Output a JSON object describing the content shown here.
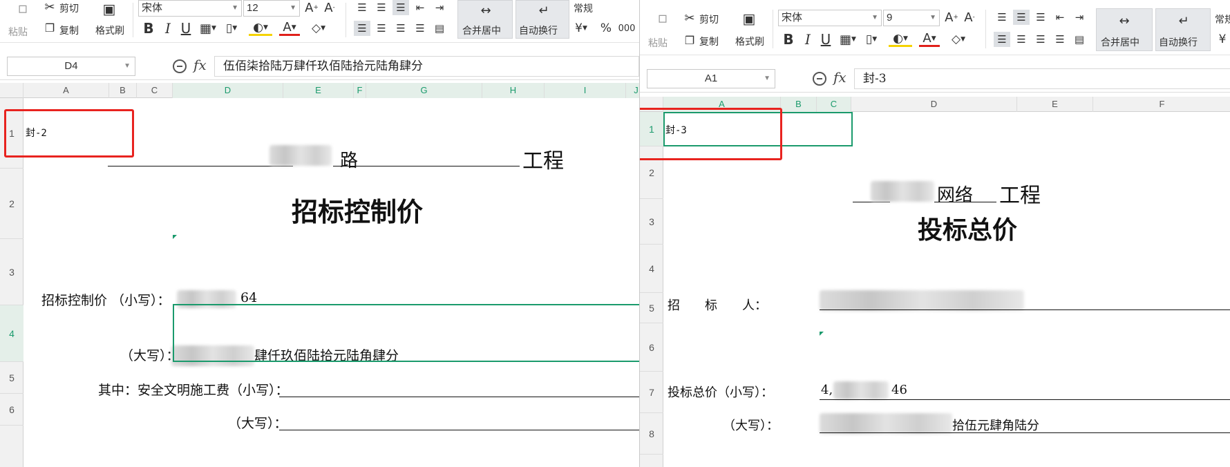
{
  "left": {
    "toolbar": {
      "cut": "剪切",
      "copy": "复制",
      "paste": "粘贴",
      "format_painter": "格式刷",
      "font_name": "宋体",
      "font_size": "12",
      "merge_center": "合并居中",
      "wrap_text": "自动换行",
      "number_format": "常规"
    },
    "name_box": "D4",
    "formula": "伍佰柒拾陆万肆仟玖佰陆拾元陆角肆分",
    "columns": [
      "A",
      "B",
      "C",
      "D",
      "E",
      "F",
      "G",
      "H",
      "I",
      "J"
    ],
    "rows": [
      "1",
      "2",
      "3",
      "4",
      "5",
      "6"
    ],
    "cells": {
      "a1": "封-2",
      "project_suffix": "工程",
      "project_mid": "路",
      "title": "招标控制价",
      "price_small_label": "招标控制价 （小写）：",
      "price_small_value": "64",
      "price_big_label": "（大写）：",
      "price_big_value": "肆仟玖佰陆拾元陆角肆分",
      "safety_small_label": "其中：安全文明施工费（小写）：",
      "safety_big_label": "（大写）："
    }
  },
  "right": {
    "toolbar": {
      "cut": "剪切",
      "copy": "复制",
      "paste": "粘贴",
      "format_painter": "格式刷",
      "font_name": "宋体",
      "font_size": "9",
      "merge_center": "合并居中",
      "wrap_text": "自动换行",
      "number_format": "常规"
    },
    "name_box": "A1",
    "formula": "封-3",
    "columns": [
      "A",
      "B",
      "C",
      "D",
      "E",
      "F"
    ],
    "rows": [
      "1",
      "2",
      "3",
      "4",
      "5",
      "6",
      "7",
      "8"
    ],
    "cells": {
      "a1": "封-3",
      "project_mid": "网络",
      "project_suffix": "工程",
      "title": "投标总价",
      "bidder_label": "招　　标　　人：",
      "total_small_label": "投标总价（小写）：",
      "total_small_prefix": "4,",
      "total_small_value": "46",
      "total_big_label": "（大写）：",
      "total_big_value": "拾伍元肆角陆分"
    }
  }
}
